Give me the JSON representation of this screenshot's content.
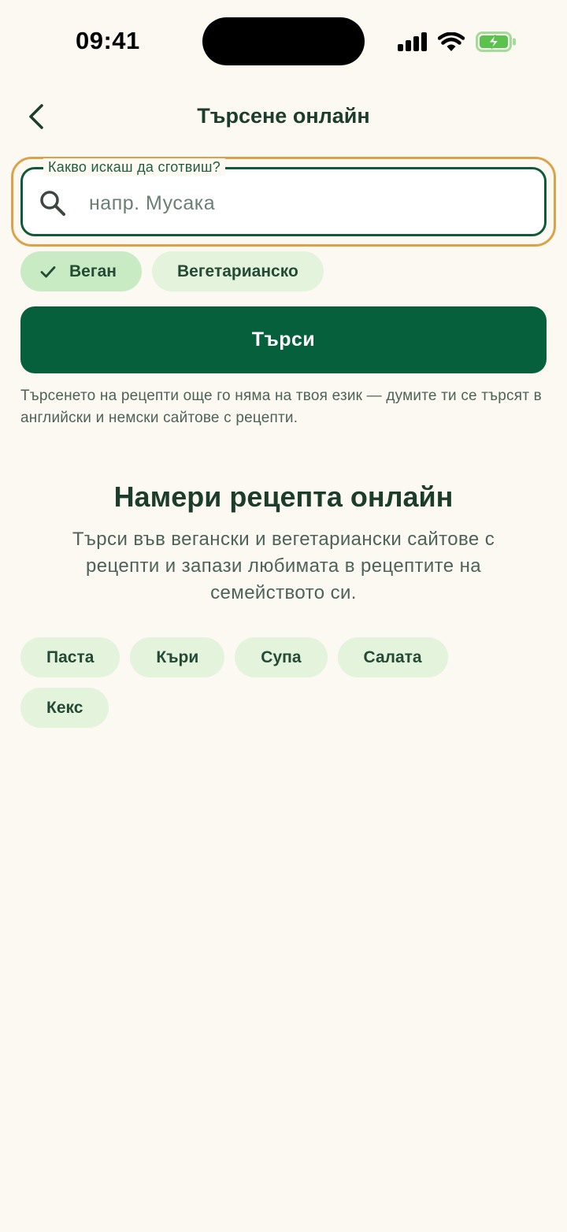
{
  "status_bar": {
    "time": "09:41"
  },
  "header": {
    "title": "Търсене онлайн",
    "back_icon": "chevron-left-icon"
  },
  "search": {
    "label": "Какво искаш да сготвиш?",
    "placeholder": "напр. Мусака",
    "value": "",
    "icon": "search-icon"
  },
  "filters": [
    {
      "label": "Веган",
      "selected": true
    },
    {
      "label": "Вегетарианско",
      "selected": false
    }
  ],
  "search_button": {
    "label": "Търси"
  },
  "note": "Търсенето на рецепти още го няма на твоя език — думите ти се търсят в английски и немски сайтове с рецепти.",
  "empty_state": {
    "title": "Намери рецепта онлайн",
    "subtitle": "Търси във вегански и вегетариански сайтове с рецепти и запази любимата в рецептите на семейството си."
  },
  "suggestions": [
    "Паста",
    "Къри",
    "Супа",
    "Салата",
    "Кекс"
  ],
  "colors": {
    "background": "#fbf9f1",
    "primary": "#07603c",
    "chip": "#e3f3dc",
    "chip_selected": "#c8ebc4",
    "focus_ring": "#dba24a",
    "battery_charging": "#5bc24e"
  }
}
